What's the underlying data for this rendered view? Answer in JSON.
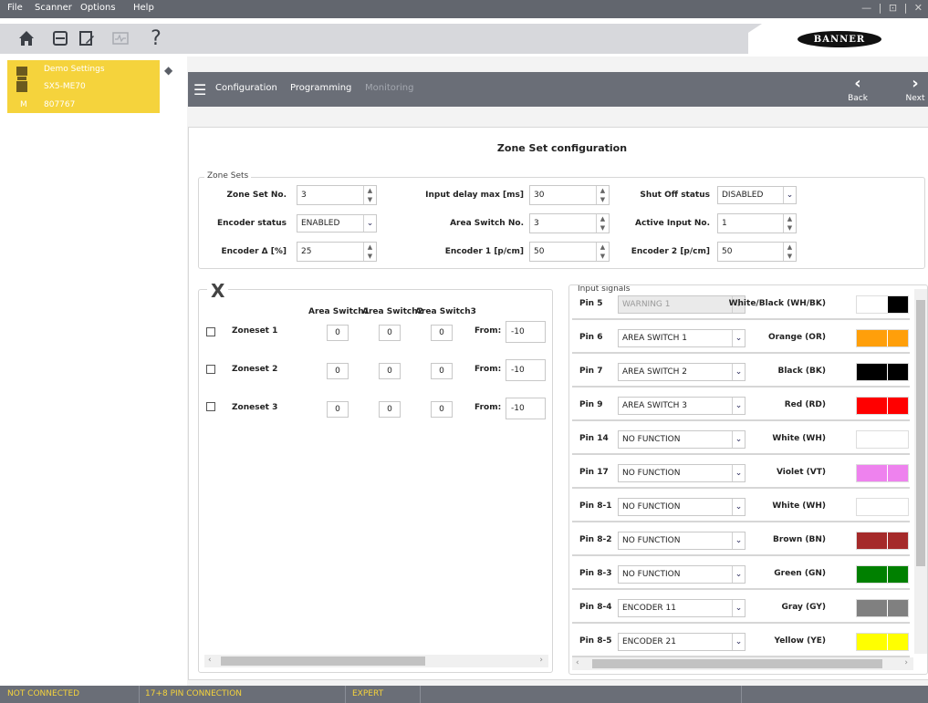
{
  "menu": {
    "items": [
      "File",
      "Scanner",
      "Options",
      "Help"
    ],
    "window_controls": "— | ⊡ | ✕"
  },
  "toolbar": {
    "icons": [
      "home-icon",
      "save-icon",
      "document-edit-icon",
      "monitor-icon",
      "help-icon"
    ],
    "help_glyph": "?"
  },
  "brand": {
    "logo_text": "BANNER"
  },
  "device": {
    "name": "Demo Settings",
    "model": "SX5-ME70",
    "mode": "M",
    "serial": "807767"
  },
  "nav": {
    "tabs": [
      "Configuration",
      "Programming",
      "Monitoring"
    ],
    "back_label": "Back",
    "next_label": "Next"
  },
  "page": {
    "title": "Zone Set configuration"
  },
  "zone_sets": {
    "legend": "Zone Sets",
    "fields": [
      {
        "label": "Zone Set No.",
        "value": "3",
        "kind": "spin"
      },
      {
        "label": "Input delay max [ms]",
        "value": "30",
        "kind": "spin"
      },
      {
        "label": "Shut Off status",
        "value": "DISABLED",
        "kind": "select"
      },
      {
        "label": "Encoder status",
        "value": "ENABLED",
        "kind": "select"
      },
      {
        "label": "Area Switch No.",
        "value": "3",
        "kind": "spin"
      },
      {
        "label": "Active Input No.",
        "value": "1",
        "kind": "spin"
      },
      {
        "label": "Encoder Δ [%]",
        "value": "25",
        "kind": "spin"
      },
      {
        "label": "Encoder 1 [p/cm]",
        "value": "50",
        "kind": "spin"
      },
      {
        "label": "Encoder 2 [p/cm]",
        "value": "50",
        "kind": "spin"
      }
    ]
  },
  "zoneset_panel": {
    "header": "X",
    "columns": [
      "Area Switch1",
      "Area Switch2",
      "Area Switch3"
    ],
    "from_label": "From:",
    "rows": [
      {
        "name": "Zoneset 1",
        "values": [
          "0",
          "0",
          "0"
        ],
        "from": "-10"
      },
      {
        "name": "Zoneset 2",
        "values": [
          "0",
          "0",
          "0"
        ],
        "from": "-10"
      },
      {
        "name": "Zoneset 3",
        "values": [
          "0",
          "0",
          "0"
        ],
        "from": "-10"
      }
    ]
  },
  "input_signals": {
    "legend": "Input signals",
    "rows": [
      {
        "pin": "Pin 5",
        "function": "WARNING 1",
        "disabled": true,
        "color_name": "White/Black (WH/BK)",
        "left": "#ffffff",
        "right": "#000000"
      },
      {
        "pin": "Pin 6",
        "function": "AREA SWITCH 1",
        "disabled": false,
        "color_name": "Orange (OR)",
        "left": "#ff9f0a",
        "right": "#ff9f0a"
      },
      {
        "pin": "Pin 7",
        "function": "AREA SWITCH 2",
        "disabled": false,
        "color_name": "Black (BK)",
        "left": "#000000",
        "right": "#000000"
      },
      {
        "pin": "Pin 9",
        "function": "AREA SWITCH 3",
        "disabled": false,
        "color_name": "Red (RD)",
        "left": "#ff0000",
        "right": "#ff0000"
      },
      {
        "pin": "Pin 14",
        "function": "NO FUNCTION",
        "disabled": false,
        "color_name": "White (WH)",
        "left": "#ffffff",
        "right": "#ffffff"
      },
      {
        "pin": "Pin 17",
        "function": "NO FUNCTION",
        "disabled": false,
        "color_name": "Violet (VT)",
        "left": "#ee82ee",
        "right": "#ee82ee"
      },
      {
        "pin": "Pin 8-1",
        "function": "NO FUNCTION",
        "disabled": false,
        "color_name": "White (WH)",
        "left": "#ffffff",
        "right": "#ffffff"
      },
      {
        "pin": "Pin 8-2",
        "function": "NO FUNCTION",
        "disabled": false,
        "color_name": "Brown (BN)",
        "left": "#a52a2a",
        "right": "#a52a2a"
      },
      {
        "pin": "Pin 8-3",
        "function": "NO FUNCTION",
        "disabled": false,
        "color_name": "Green (GN)",
        "left": "#008000",
        "right": "#008000"
      },
      {
        "pin": "Pin 8-4",
        "function": "ENCODER 11",
        "disabled": false,
        "color_name": "Gray (GY)",
        "left": "#808080",
        "right": "#808080"
      },
      {
        "pin": "Pin 8-5",
        "function": "ENCODER 21",
        "disabled": false,
        "color_name": "Yellow (YE)",
        "left": "#ffff00",
        "right": "#ffff00"
      }
    ]
  },
  "status": {
    "items": [
      "NOT CONNECTED",
      "17+8 PIN CONNECTION",
      "EXPERT"
    ],
    "text_color": "#f5d33c"
  }
}
